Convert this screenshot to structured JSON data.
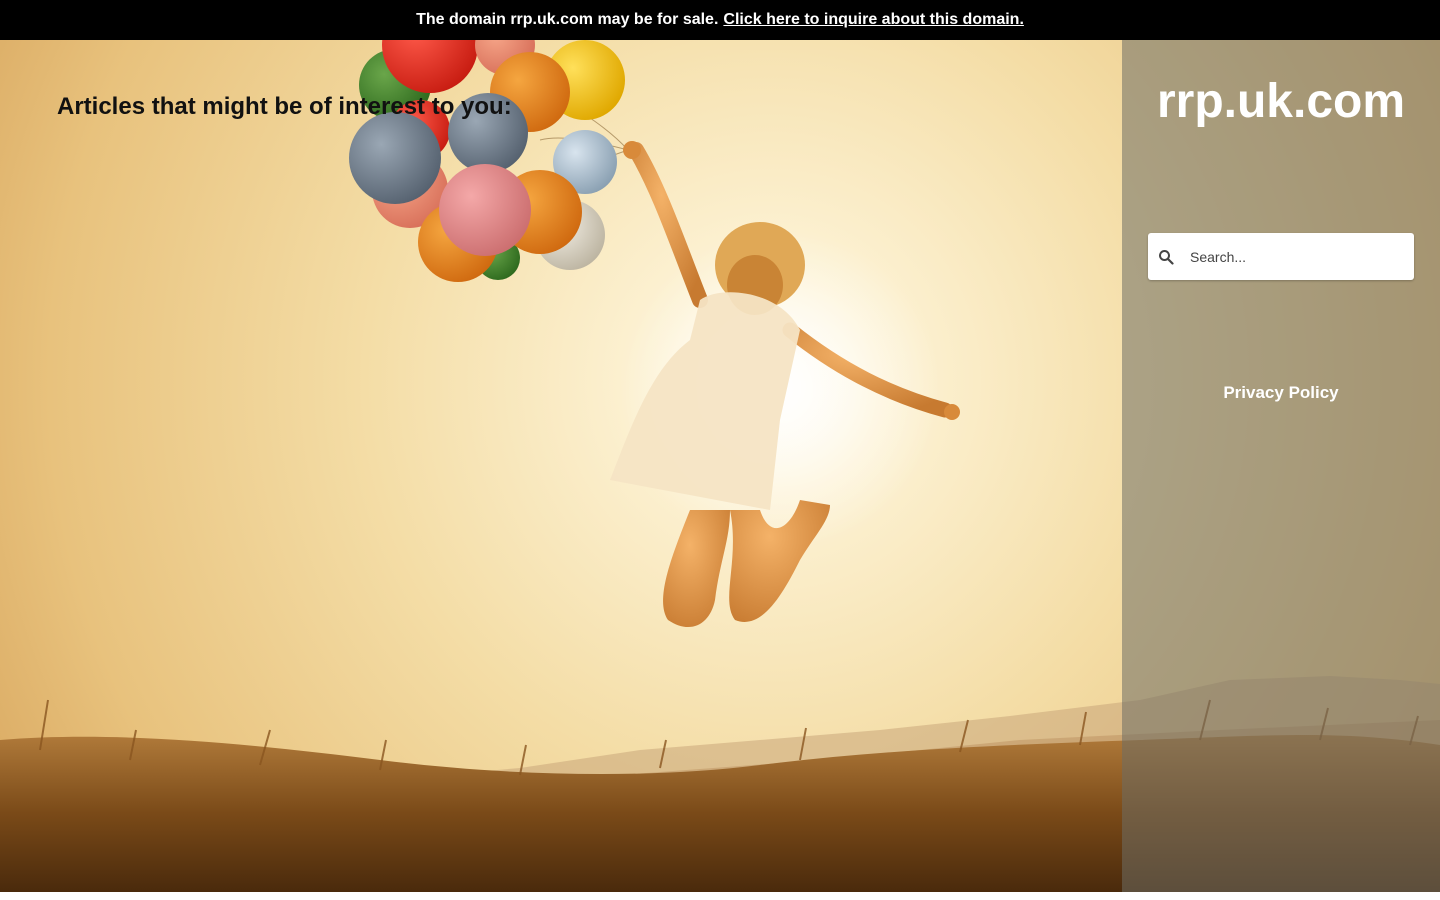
{
  "topbar": {
    "sale_text": "The domain rrp.uk.com may be for sale.",
    "inquire_link": "Click here to inquire about this domain."
  },
  "main": {
    "heading": "Articles that might be of interest to you:"
  },
  "sidebar": {
    "site_name": "rrp.uk.com",
    "search_placeholder": "Search...",
    "privacy_link": "Privacy Policy"
  },
  "colors": {
    "topbar_bg": "#000000",
    "sidebar_overlay": "#6e6e64",
    "sky_light": "#fbf1d4",
    "sky_warm": "#f2cf87",
    "grass": "#7a4a18"
  },
  "icons": {
    "search": "search-icon"
  }
}
